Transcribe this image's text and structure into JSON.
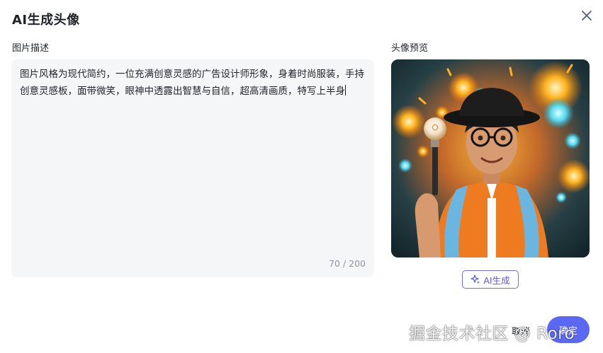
{
  "dialog": {
    "title": "AI生成头像",
    "close_icon": "close-icon"
  },
  "description": {
    "label": "图片描述",
    "value": "图片风格为现代简约，一位充满创意灵感的广告设计师形象，身着时尚服装，手持创意灵感板，面带微笑，眼神中透露出智慧与自信，超高清画质，特写上半身",
    "counter": "70 / 200"
  },
  "preview": {
    "label": "头像预览",
    "image_subject": "smiling young man with black hat, round glasses, orange shirt, holding a light bulb against glowing sparkles"
  },
  "actions": {
    "ai_generate_label": "AI生成",
    "ai_generate_icon": "sparkle-icon",
    "cancel_label": "取消",
    "ok_label": "确定"
  },
  "watermark": "掘金技术社区 @ Roro",
  "colors": {
    "accent": "#5b68f2",
    "ai_button": "#5a55e8",
    "textarea_bg": "#f5f6f8",
    "muted_text": "#8f959e"
  }
}
